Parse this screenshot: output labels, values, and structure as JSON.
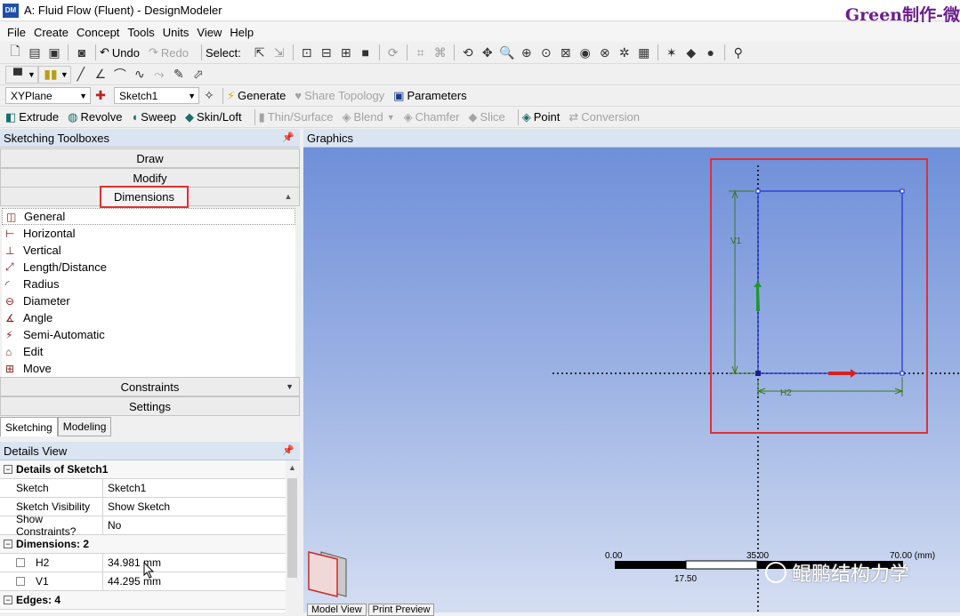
{
  "window": {
    "title": "A: Fluid Flow (Fluent) - DesignModeler",
    "app_icon": "DM",
    "watermark": "Green制作-微"
  },
  "menu": [
    "File",
    "Create",
    "Concept",
    "Tools",
    "Units",
    "View",
    "Help"
  ],
  "toolbar1": {
    "undo": "Undo",
    "redo": "Redo",
    "select": "Select:"
  },
  "toolbar3": {
    "plane": "XYPlane",
    "sketch": "Sketch1",
    "generate": "Generate",
    "share_topology": "Share Topology",
    "parameters": "Parameters"
  },
  "toolbar4": {
    "extrude": "Extrude",
    "revolve": "Revolve",
    "sweep": "Sweep",
    "skin_loft": "Skin/Loft",
    "thin_surface": "Thin/Surface",
    "blend": "Blend",
    "chamfer": "Chamfer",
    "slice": "Slice",
    "point": "Point",
    "conversion": "Conversion"
  },
  "toolboxes": {
    "header": "Sketching Toolboxes",
    "draw": "Draw",
    "modify": "Modify",
    "dimensions": "Dimensions",
    "items": [
      "General",
      "Horizontal",
      "Vertical",
      "Length/Distance",
      "Radius",
      "Diameter",
      "Angle",
      "Semi-Automatic",
      "Edit",
      "Move"
    ],
    "constraints": "Constraints",
    "settings": "Settings"
  },
  "tabs": {
    "sketching": "Sketching",
    "modeling": "Modeling"
  },
  "details": {
    "header": "Details View",
    "group1": "Details of Sketch1",
    "sketch_label": "Sketch",
    "sketch_value": "Sketch1",
    "visibility_label": "Sketch Visibility",
    "visibility_value": "Show Sketch",
    "constraints_label": "Show Constraints?",
    "constraints_value": "No",
    "group2": "Dimensions: 2",
    "h2_label": "H2",
    "h2_value": "34.981 mm",
    "v1_label": "V1",
    "v1_value": "44.295 mm",
    "group3": "Edges: 4"
  },
  "graphics": {
    "header": "Graphics",
    "v1_label": "V1",
    "h2_label": "H2",
    "scale": {
      "t0": "0.00",
      "t1": "35.00",
      "t2": "70.00 (mm)",
      "tm": "17.50"
    },
    "tab_model": "Model View",
    "tab_print": "Print Preview",
    "watermark": "鲲鹏结构力学"
  }
}
